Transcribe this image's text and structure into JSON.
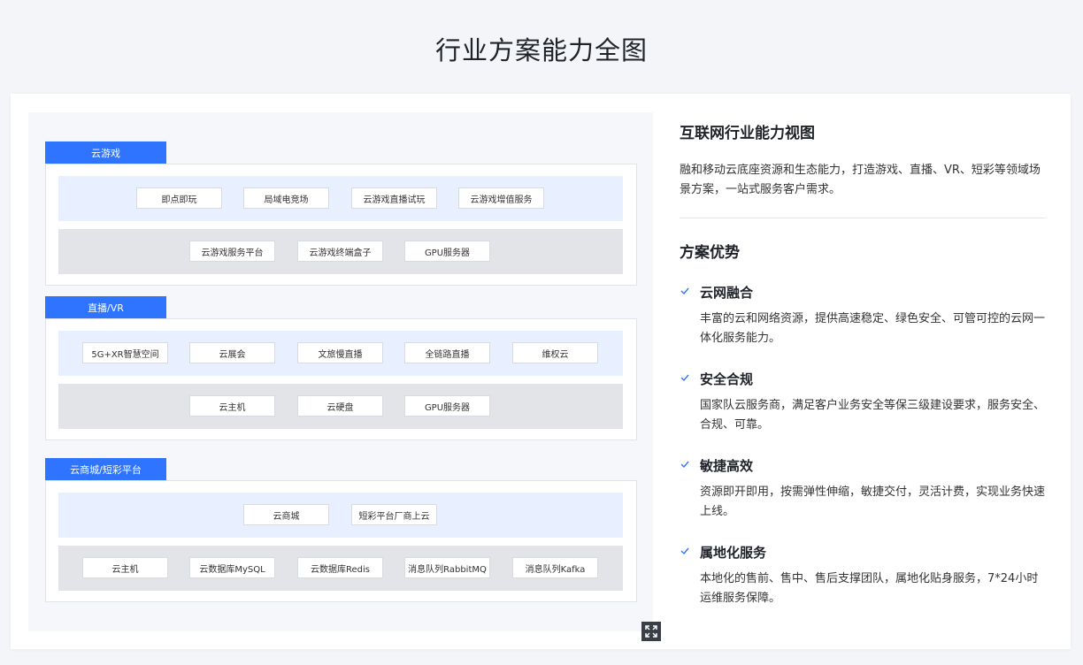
{
  "page": {
    "title": "行业方案能力全图"
  },
  "diagram": {
    "sections": [
      {
        "tab": "云游戏",
        "row1": [
          "即点即玩",
          "局域电竞场",
          "云游戏直播试玩",
          "云游戏增值服务"
        ],
        "row2": [
          "云游戏服务平台",
          "云游戏终端盒子",
          "GPU服务器"
        ]
      },
      {
        "tab": "直播/VR",
        "row1": [
          "5G+XR智慧空间",
          "云展会",
          "文旅慢直播",
          "全链路直播",
          "维权云"
        ],
        "row2": [
          "云主机",
          "云硬盘",
          "GPU服务器"
        ]
      },
      {
        "tab": "云商城/短彩平台",
        "row1": [
          "云商城",
          "短彩平台厂商上云"
        ],
        "row2": [
          "云主机",
          "云数据库MySQL",
          "云数据库Redis",
          "消息队列RabbitMQ",
          "消息队列Kafka"
        ]
      }
    ],
    "expand_icon": "expand-icon"
  },
  "info": {
    "title": "互联网行业能力视图",
    "intro": "融和移动云底座资源和生态能力，打造游戏、直播、VR、短彩等领域场景方案，一站式服务客户需求。",
    "advantages_title": "方案优势",
    "advantages": [
      {
        "name": "云网融合",
        "desc": "丰富的云和网络资源，提供高速稳定、绿色安全、可管可控的云网一体化服务能力。"
      },
      {
        "name": "安全合规",
        "desc": "国家队云服务商，满足客户业务安全等保三级建设要求，服务安全、合规、可靠。"
      },
      {
        "name": "敏捷高效",
        "desc": "资源即开即用，按需弹性伸缩，敏捷交付，灵活计费，实现业务快速上线。"
      },
      {
        "name": "属地化服务",
        "desc": "本地化的售前、售中、售后支撑团队，属地化贴身服务，7*24小时运维服务保障。"
      }
    ]
  },
  "colors": {
    "accent": "#2e74ff",
    "row_blue": "#e8f0ff",
    "row_gray": "#e3e4e7"
  }
}
